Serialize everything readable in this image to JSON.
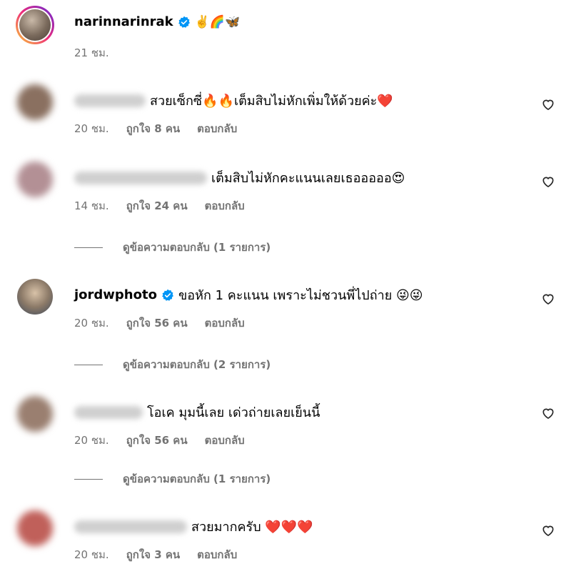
{
  "post": {
    "username": "narinnarinrak",
    "caption": "✌️🌈🦋",
    "time": "21 ชม."
  },
  "comments": [
    {
      "text": "สวยเซ็กซี่🔥🔥เต็มสิบไม่หักเพิ่มให้ด้วยค่ะ❤️",
      "time": "20 ชม.",
      "likes": "ถูกใจ 8 คน",
      "reply": "ตอบกลับ"
    },
    {
      "text": "เต็มสิบไม่หักคะแนนเลยเธอออออ😍",
      "time": "14 ชม.",
      "likes": "ถูกใจ 24 คน",
      "reply": "ตอบกลับ",
      "view_replies": "ดูข้อความตอบกลับ (1 รายการ)"
    },
    {
      "username": "jordwphoto",
      "text": "ขอหัก 1 คะแนน เพราะไม่ชวนพี่ไปถ่าย 😜😜",
      "time": "20 ชม.",
      "likes": "ถูกใจ 56 คน",
      "reply": "ตอบกลับ",
      "view_replies": "ดูข้อความตอบกลับ (2 รายการ)"
    },
    {
      "text": "โอเค มุมนี้เลย เด่วถ่ายเลยเย็นนี้",
      "time": "20 ชม.",
      "likes": "ถูกใจ 56 คน",
      "reply": "ตอบกลับ",
      "view_replies": "ดูข้อความตอบกลับ (1 รายการ)"
    },
    {
      "text": "สวยมากครับ ❤️❤️❤️",
      "time": "20 ชม.",
      "likes": "ถูกใจ 3 คน",
      "reply": "ตอบกลับ"
    }
  ],
  "icons": {
    "heart": "heart-outline-icon",
    "verified": "verified-badge-icon"
  },
  "colors": {
    "verified": "#0095f6",
    "muted": "#737373"
  }
}
